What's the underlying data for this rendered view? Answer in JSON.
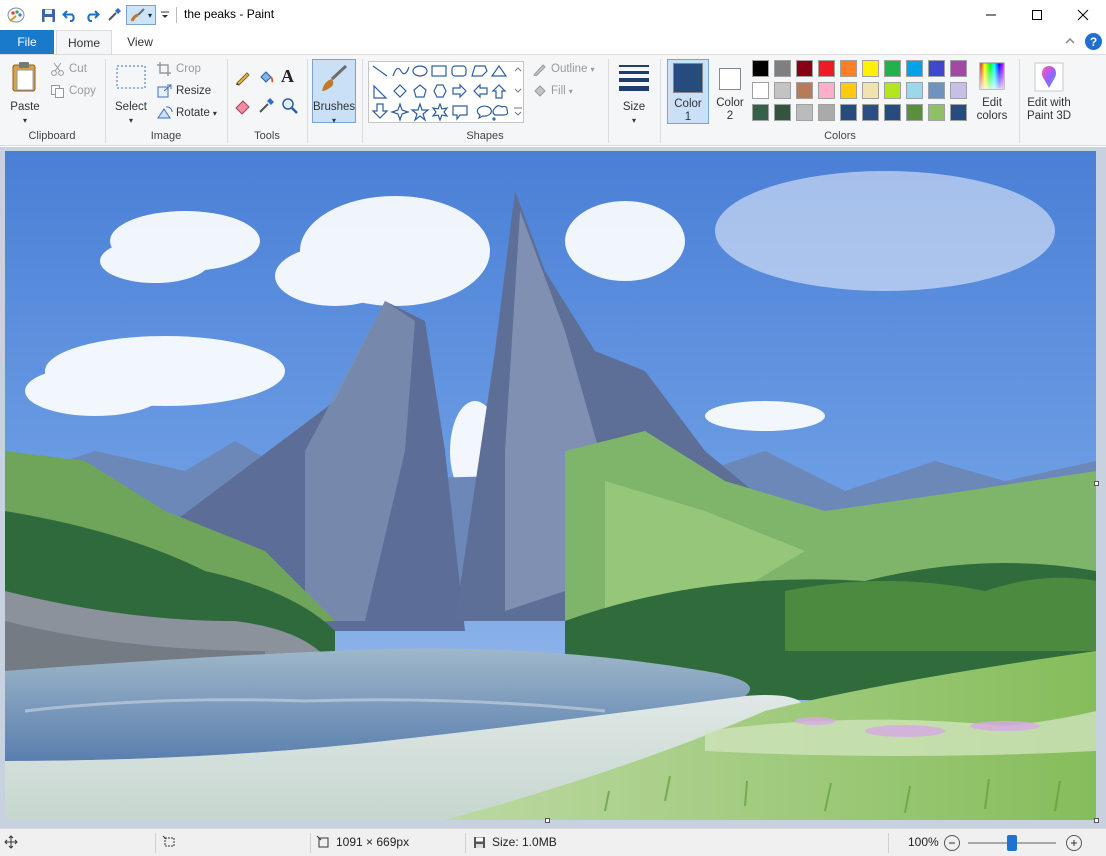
{
  "window": {
    "title": "the peaks - Paint"
  },
  "tabs": {
    "file": "File",
    "home": "Home",
    "view": "View"
  },
  "clipboard": {
    "paste": "Paste",
    "cut": "Cut",
    "copy": "Copy",
    "label": "Clipboard"
  },
  "image": {
    "select": "Select",
    "crop": "Crop",
    "resize": "Resize",
    "rotate": "Rotate",
    "label": "Image"
  },
  "tools": {
    "label": "Tools"
  },
  "brushes": {
    "label": "Brushes"
  },
  "shapes": {
    "outline": "Outline",
    "fill": "Fill",
    "label": "Shapes"
  },
  "size": {
    "label": "Size"
  },
  "colors": {
    "color1_label": "Color",
    "color1_num": "1",
    "color2_label": "Color",
    "color2_num": "2",
    "edit_label": "Edit",
    "edit_label2": "colors",
    "label": "Colors",
    "color1": "#264b7d",
    "color2": "#ffffff",
    "palette_row1": [
      "#000000",
      "#7f7f7f",
      "#880015",
      "#ed1c24",
      "#ff7f27",
      "#fff200",
      "#22b14c",
      "#00a2e8",
      "#3f48cc",
      "#a349a4"
    ],
    "palette_row2": [
      "#ffffff",
      "#c3c3c3",
      "#b97a57",
      "#ffaec9",
      "#ffc90e",
      "#efe4b0",
      "#b5e61d",
      "#99d9ea",
      "#7092be",
      "#c8bfe7"
    ],
    "palette_row3": [
      "#37604a",
      "#33553f",
      "#bbbbbb",
      "#aaaaaa",
      "#264b7d",
      "#2b4f82",
      "#264b7d",
      "#5c8f3c",
      "#8fbf66",
      "#264b7d"
    ]
  },
  "paint3d": {
    "label": "Edit with",
    "label2": "Paint 3D"
  },
  "status": {
    "dimensions": "1091 × 669px",
    "size": "Size: 1.0MB",
    "zoom": "100%"
  }
}
